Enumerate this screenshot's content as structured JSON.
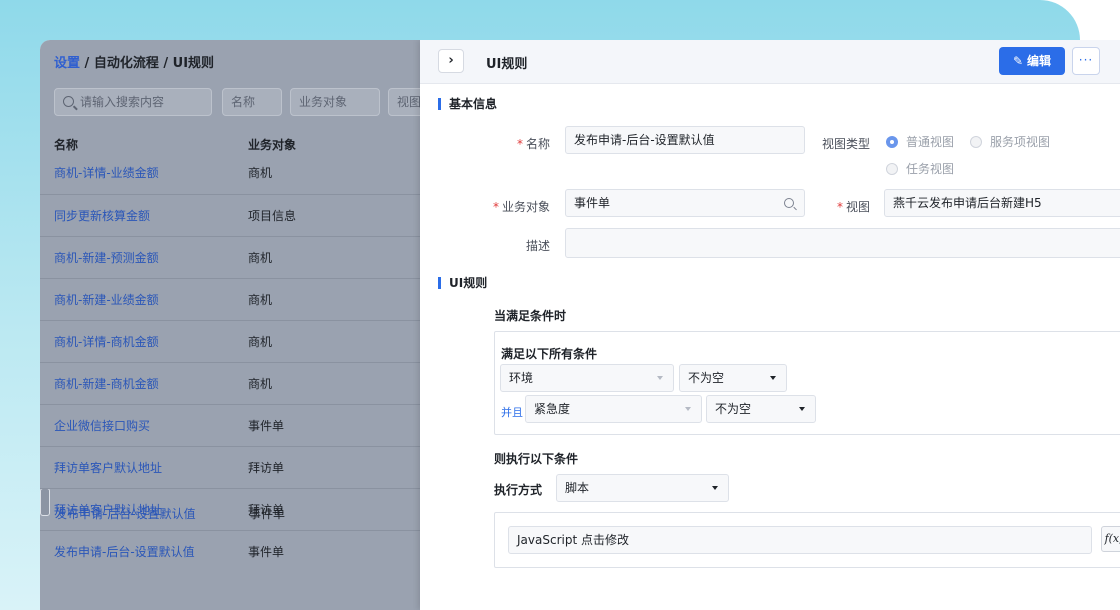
{
  "breadcrumb": {
    "root": "设置",
    "sep1": "/",
    "middle": "自动化流程",
    "sep2": "/",
    "current": "UI规则"
  },
  "filters": {
    "search_placeholder": "请输入搜索内容",
    "col_name": "名称",
    "col_object": "业务对象",
    "col_view": "视图"
  },
  "table": {
    "headers": [
      "名称",
      "业务对象"
    ],
    "rows": [
      {
        "name": "商机-详情-业绩金额",
        "object": "商机"
      },
      {
        "name": "同步更新核算金额",
        "object": "项目信息"
      },
      {
        "name": "商机-新建-预测金额",
        "object": "商机"
      },
      {
        "name": "商机-新建-业绩金额",
        "object": "商机"
      },
      {
        "name": "商机-详情-商机金额",
        "object": "商机"
      },
      {
        "name": "商机-新建-商机金额",
        "object": "商机"
      },
      {
        "name": "企业微信接口购买",
        "object": "事件单"
      },
      {
        "name": "拜访单客户默认地址",
        "object": "拜访单"
      },
      {
        "name": "发布申请-后台-设置默认值",
        "object": "事件单",
        "selected": true
      },
      {
        "name": "拜访单客户默认地址",
        "object": "拜访单"
      },
      {
        "name": "发布申请-后台-设置默认值",
        "object": "事件单"
      }
    ]
  },
  "detail": {
    "expand_glyph": "›",
    "title": "UI规则",
    "edit_label": "编辑",
    "more_label": "···",
    "basic_section": "基本信息",
    "name_label": "名称",
    "name_value": "发布申请-后台-设置默认值",
    "view_type_label": "视图类型",
    "view_type_options": [
      "普通视图",
      "服务项视图",
      "任务视图"
    ],
    "view_type_selected": "普通视图",
    "object_label": "业务对象",
    "object_value": "事件单",
    "view_label": "视图",
    "view_value": "燕千云发布申请后台新建H5",
    "desc_label": "描述",
    "desc_value": "",
    "rules_section": "UI规则",
    "when_label": "当满足条件时",
    "all_conditions": "满足以下所有条件",
    "conditions": [
      {
        "field": "环境",
        "op": "不为空"
      },
      {
        "connector": "并且",
        "field": "紧急度",
        "op": "不为空"
      }
    ],
    "then_label": "则执行以下条件",
    "exec_mode_label": "执行方式",
    "exec_mode_value": "脚本",
    "script_value": "JavaScript 点击修改",
    "fx_label": "f(x)"
  },
  "colors": {
    "accent": "#2b6de8",
    "link": "#2a56b8",
    "required": "#e03a3a",
    "bg_gradient": "#8fd9ea"
  }
}
